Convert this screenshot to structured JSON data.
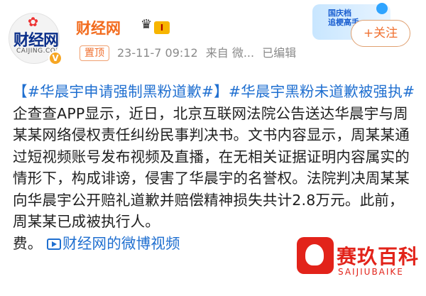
{
  "account": {
    "name": "财经网",
    "level": "I",
    "follow_label": "+关注",
    "avatar_text": "财经网",
    "avatar_subtext": "CAIJING.COM",
    "verified": "V"
  },
  "post_meta": {
    "pinned_label": "置顶",
    "timestamp": "23-11-7 09:12",
    "source": "来自 微...",
    "edited": "已编辑"
  },
  "sticker": {
    "text_line1": "国庆档",
    "text_line2": "追梗高手"
  },
  "post": {
    "hashtag1": "【#华晨宇申请强制黑粉道歉#】",
    "hashtag2": "#华晨宇黑粉未道歉被强执#",
    "body": "企查查APP显示，近日，北京互联网法院公告送达华晨宇与周某某网络侵权责任纠纷民事判决书。文书内容显示，周某某通过短视频账号发布视频及直播，在无相关证据证明内容属实的情形下，构成诽谤，侵害了华晨宇的名誉权。法院判决周某某向华晨宇公开赔礼道歉并赔偿精神损失共计2.8万元。此前，周某某已成被执行人。",
    "tail": "费。",
    "video_link": "财经网的微博视频"
  },
  "watermark": {
    "title": "赛玖百科",
    "subtitle": "SAIJIUBAIKE"
  },
  "colors": {
    "name_orange": "#f26b1d",
    "link_blue": "#1f6fd0",
    "watermark_red": "#e2231a"
  }
}
